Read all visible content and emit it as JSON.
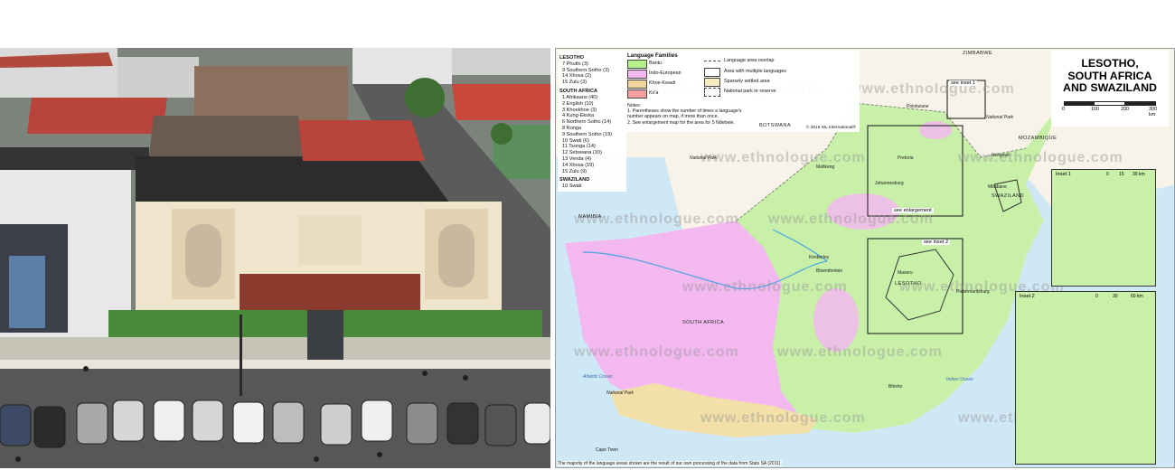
{
  "map": {
    "title_lines": [
      "LESOTHO,",
      "SOUTH AFRICA",
      "AND SWAZILAND"
    ],
    "watermark": "www.ethnologue.com",
    "left_legend": [
      {
        "heading": "LESOTHO",
        "items": [
          "7 Phuthi (3)",
          "9 Southern Sotho (3)",
          "14 Xhosa (2)",
          "15 Zulu (3)"
        ]
      },
      {
        "heading": "SOUTH AFRICA",
        "items": [
          "1 Afrikaans (40)",
          "2 English (10)",
          "3 Khoekhoe (3)",
          "4 Kung-Ekoka",
          "6 Northern Sotho (14)",
          "8 Ronga",
          "9 Southern Sotho (19)",
          "10 Swati (6)",
          "11 Tsonga (14)",
          "12 Setswana (10)",
          "13 Venda (4)",
          "14 Xhosa (19)",
          "15 Zulu (9)"
        ]
      },
      {
        "heading": "SWAZILAND",
        "items": [
          "10 Swati"
        ]
      }
    ],
    "families_title": "Language Families",
    "families": [
      {
        "label": "Bantu",
        "color": "#b6f08c"
      },
      {
        "label": "Indo-European",
        "color": "#f3b8f0"
      },
      {
        "label": "Khoe-Kwadi",
        "color": "#f0d49a"
      },
      {
        "label": "Kx'a",
        "color": "#f2a0a0"
      }
    ],
    "area_keys": [
      {
        "label": "Language area overlap",
        "style": "dashed"
      },
      {
        "label": "Area with multiple languages",
        "style": "box"
      },
      {
        "label": "Sparsely settled area",
        "style": "sparse"
      },
      {
        "label": "National park or reserve",
        "style": "park"
      }
    ],
    "notes_title": "Notes:",
    "notes": [
      "1. Parentheses show the number of times a language's",
      "number appears on map, if more than once.",
      "2. See enlargement map for the area for 5 Ndebele."
    ],
    "credit": "© 2016 SIL International®",
    "scale": {
      "ticks": [
        "0",
        "100",
        "200",
        "300 km"
      ]
    },
    "inset1": {
      "title": "Inset 1",
      "ticks": [
        "0",
        "15",
        "30 km"
      ]
    },
    "inset2": {
      "title": "Inset 2",
      "ticks": [
        "0",
        "30",
        "60 km"
      ]
    },
    "enlargement_label": "see enlargement",
    "see_inset1": "see inset 1",
    "see_inset2": "see inset 2",
    "countries": [
      "ZIMBABWE",
      "BOTSWANA",
      "NAMIBIA",
      "MOZAMBIQUE",
      "SOUTH AFRICA",
      "LESOTHO",
      "SWAZILAND"
    ],
    "cities": [
      "Polokwane",
      "Pretoria",
      "Mafikeng",
      "Johannesburg",
      "Mbabane",
      "Kimberley",
      "Bloemfontein",
      "Maseru",
      "Pietermaritzburg",
      "Bhisho",
      "Cape Town",
      "Nelspruit"
    ],
    "oceans": [
      "Atlantic Ocean",
      "Indian Ocean"
    ],
    "parks": [
      "National Park",
      "National Park",
      "National Park"
    ],
    "footer": "The majority of the language areas shown are the result of our own processing of the data from Stats SA (2011)."
  },
  "photo": {
    "description_colors": {
      "building": "#efe4cc",
      "roof": "#2b2b2b",
      "tiles": "#b8443c",
      "lawn": "#4a8a3a"
    }
  }
}
